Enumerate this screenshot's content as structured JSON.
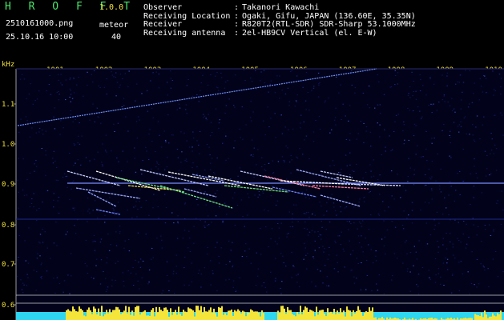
{
  "header": {
    "logo": "H R O F F T",
    "version": "1.0.0",
    "filename": "2510161000.png",
    "datetime": "25.10.16 10:00",
    "meteor_label": "meteor",
    "meteor_count": "40"
  },
  "info": [
    {
      "key": "Observer",
      "value": "Takanori Kawachi"
    },
    {
      "key": "Receiving Location",
      "value": "Ogaki, Gifu, JAPAN (136.60E, 35.35N)"
    },
    {
      "key": "Receiver",
      "value": "R820T2(RTL-SDR) SDR-Sharp 53.1000MHz"
    },
    {
      "key": "Receiving antenna",
      "value": "2el-HB9CV Vertical (el. E-W)"
    }
  ],
  "axes": {
    "y_unit": "kHz",
    "x_ticks": [
      "1001",
      "1002",
      "1003",
      "1004",
      "1005",
      "1006",
      "1007",
      "1008",
      "1009",
      "1010"
    ],
    "y_ticks": [
      "1.1",
      "1.0",
      "0.9",
      "0.8",
      "0.7",
      "0.6"
    ]
  },
  "colors": {
    "logo": "#49e86a",
    "version": "#f2e13a",
    "axis_labels": "#f2e13a",
    "signal_line": "#6f8fff",
    "meteor_trail": "#ffffff",
    "bottom_yellow": "#f5e53a",
    "bottom_cyan": "#2fd6f0"
  }
}
